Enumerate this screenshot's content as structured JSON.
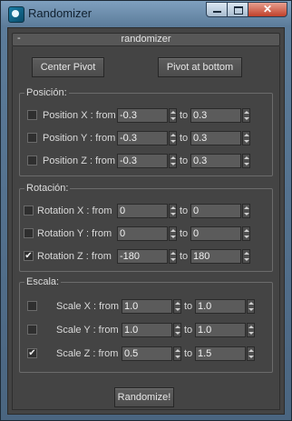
{
  "window": {
    "title": "Randomizer"
  },
  "rollout": {
    "toggle": "-",
    "name": "randomizer"
  },
  "buttons": {
    "center_pivot": "Center Pivot",
    "pivot_bottom": "Pivot at bottom",
    "randomize": "Randomize!"
  },
  "connector": "to",
  "groups": [
    {
      "label": "Posición:",
      "rows": [
        {
          "label": "Position X : from",
          "checked": false,
          "from": "-0.3",
          "to": "0.3"
        },
        {
          "label": "Position Y : from",
          "checked": false,
          "from": "-0.3",
          "to": "0.3"
        },
        {
          "label": "Position Z : from",
          "checked": false,
          "from": "-0.3",
          "to": "0.3"
        }
      ]
    },
    {
      "label": "Rotación:",
      "rows": [
        {
          "label": "Rotation X : from",
          "checked": false,
          "from": "0",
          "to": "0"
        },
        {
          "label": "Rotation Y : from",
          "checked": false,
          "from": "0",
          "to": "0"
        },
        {
          "label": "Rotation Z : from",
          "checked": true,
          "from": "-180",
          "to": "180"
        }
      ]
    },
    {
      "label": "Escala:",
      "rows": [
        {
          "label": "Scale X : from",
          "checked": false,
          "from": "1.0",
          "to": "1.0"
        },
        {
          "label": "Scale Y : from",
          "checked": false,
          "from": "1.0",
          "to": "1.0"
        },
        {
          "label": "Scale Z : from",
          "checked": true,
          "from": "0.5",
          "to": "1.5"
        }
      ]
    }
  ],
  "colors": {
    "panel": "#444444",
    "field": "#5b5b5b",
    "titlebar": "#7fa0bf",
    "close": "#c0402a"
  }
}
